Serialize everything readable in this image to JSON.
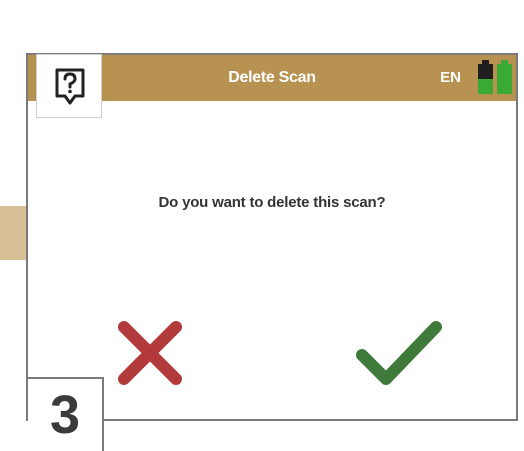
{
  "header": {
    "title": "Delete Scan",
    "language": "EN",
    "color": "#b89250"
  },
  "dialog": {
    "question": "Do you want to delete this scan?"
  },
  "buttons": {
    "cancel_icon": "x-icon",
    "cancel_color": "#b33a3a",
    "confirm_icon": "checkmark-icon",
    "confirm_color": "#3f7a3a"
  },
  "status": {
    "batteries": [
      {
        "icon": "battery-icon",
        "level": 0.5
      },
      {
        "icon": "battery-icon",
        "level": 1.0
      }
    ],
    "battery_color": "#3aaa35"
  },
  "help": {
    "icon": "help-icon"
  },
  "step": {
    "number": "3"
  }
}
